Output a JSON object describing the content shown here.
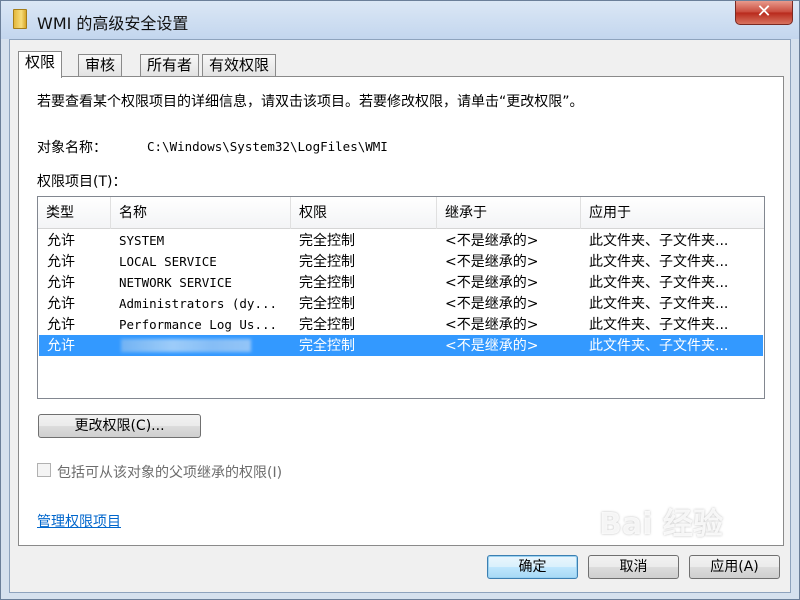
{
  "window": {
    "title": "WMI 的高级安全设置",
    "close_glyph": "✕"
  },
  "tabs": [
    {
      "label": "权限",
      "active": true
    },
    {
      "label": "审核",
      "active": false
    },
    {
      "label": "所有者",
      "active": false
    },
    {
      "label": "有效权限",
      "active": false
    }
  ],
  "description": "若要查看某个权限项目的详细信息，请双击该项目。若要修改权限，请单击“更改权限”。",
  "object_name": {
    "label": "对象名称：",
    "value": "C:\\Windows\\System32\\LogFiles\\WMI"
  },
  "permissions": {
    "label": "权限项目(T)：",
    "columns": [
      "类型",
      "名称",
      "权限",
      "继承于",
      "应用于"
    ],
    "rows": [
      {
        "type": "允许",
        "name": "SYSTEM",
        "permission": "完全控制",
        "inherited": "<不是继承的>",
        "applies": "此文件夹、子文件夹..."
      },
      {
        "type": "允许",
        "name": "LOCAL SERVICE",
        "permission": "完全控制",
        "inherited": "<不是继承的>",
        "applies": "此文件夹、子文件夹..."
      },
      {
        "type": "允许",
        "name": "NETWORK SERVICE",
        "permission": "完全控制",
        "inherited": "<不是继承的>",
        "applies": "此文件夹、子文件夹..."
      },
      {
        "type": "允许",
        "name": "Administrators (dy...",
        "permission": "完全控制",
        "inherited": "<不是继承的>",
        "applies": "此文件夹、子文件夹..."
      },
      {
        "type": "允许",
        "name": "Performance Log Us...",
        "permission": "完全控制",
        "inherited": "<不是继承的>",
        "applies": "此文件夹、子文件夹..."
      },
      {
        "type": "允许",
        "name": "",
        "permission": "完全控制",
        "inherited": "<不是继承的>",
        "applies": "此文件夹、子文件夹...",
        "selected": true,
        "name_redacted": true
      }
    ]
  },
  "change_permissions_button": "更改权限(C)...",
  "include_inheritable": {
    "label": "包括可从该对象的父项继承的权限(I)",
    "checked": false,
    "enabled": false
  },
  "manage_link": "管理权限项目",
  "footer": {
    "ok": "确定",
    "cancel": "取消",
    "apply": "应用(A)"
  },
  "watermark": "Bai 经验"
}
